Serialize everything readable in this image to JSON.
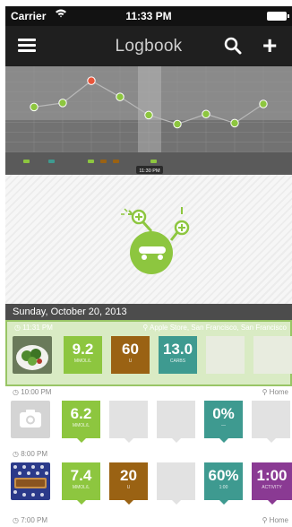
{
  "status_bar": {
    "carrier": "Carrier",
    "time": "11:33 PM"
  },
  "nav": {
    "title": "Logbook",
    "icons": [
      "menu-icon",
      "search-icon",
      "add-icon"
    ]
  },
  "chart_data": {
    "type": "line",
    "title": "",
    "xlabel": "",
    "ylabel": "",
    "grid": true,
    "highlight_label": "11:30 PM",
    "series": [
      {
        "values": [
          {
            "x": 1,
            "y": 4.5
          },
          {
            "x": 2,
            "y": 4.9
          },
          {
            "x": 3,
            "y": 7.1
          },
          {
            "x": 4,
            "y": 5.5
          },
          {
            "x": 5,
            "y": 3.7
          },
          {
            "x": 6,
            "y": 2.8
          },
          {
            "x": 7,
            "y": 3.8
          },
          {
            "x": 8,
            "y": 2.9
          },
          {
            "x": 9,
            "y": 4.8
          }
        ]
      }
    ],
    "colors": {
      "point": "#8dc63f",
      "point_high": "#e8553a",
      "line": "#b8b8b8"
    }
  },
  "empty_state": {
    "icon": "skateboard-mascot-icon",
    "color": "#8dc63f"
  },
  "date_header": "Sunday, October 20, 2013",
  "entries": [
    {
      "time": "◷ 11:31 PM",
      "location": "⚲ Apple Store, San Francisco, San Francisco",
      "photo": "salad-photo",
      "tiles": [
        {
          "type": "bg",
          "value": "9.2",
          "unit": "MMOL/L"
        },
        {
          "type": "insulin",
          "value": "60",
          "unit": "U"
        },
        {
          "type": "carbs",
          "value": "13.0",
          "unit": "CARBS"
        },
        {
          "type": "empty",
          "value": "",
          "unit": ""
        },
        {
          "type": "empty",
          "value": "",
          "unit": ""
        }
      ]
    },
    {
      "time": "◷ 10:00 PM",
      "location": "⚲ Home",
      "photo": "camera-placeholder",
      "tiles": [
        {
          "type": "bg",
          "value": "6.2",
          "unit": "MMOL/L"
        },
        {
          "type": "empty",
          "value": "",
          "unit": ""
        },
        {
          "type": "empty",
          "value": "",
          "unit": ""
        },
        {
          "type": "carbs",
          "value": "0%",
          "unit": "—"
        },
        {
          "type": "empty",
          "value": "",
          "unit": ""
        }
      ]
    },
    {
      "time": "◷ 8:00 PM",
      "location": "",
      "photo": "bar-photo",
      "tiles": [
        {
          "type": "bg",
          "value": "7.4",
          "unit": "MMOL/L"
        },
        {
          "type": "insulin",
          "value": "20",
          "unit": "U"
        },
        {
          "type": "empty",
          "value": "",
          "unit": ""
        },
        {
          "type": "carbs",
          "value": "60%",
          "unit": "1:00"
        },
        {
          "type": "activity",
          "value": "1:00",
          "unit": "ACTIVITY"
        }
      ]
    },
    {
      "time": "◷ 7:00 PM",
      "location": "⚲ Home"
    }
  ]
}
